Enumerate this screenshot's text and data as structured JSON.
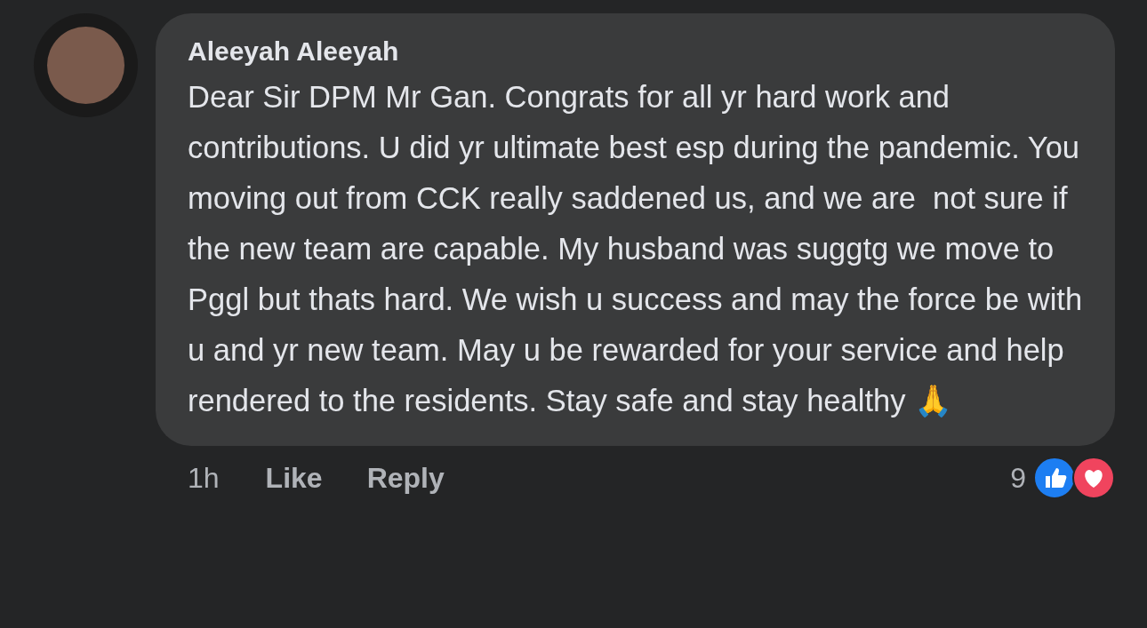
{
  "comment": {
    "author": "Aleeyah Aleeyah",
    "text": "Dear Sir DPM Mr Gan. Congrats for all yr hard work and contributions. U did yr ultimate best esp during the pandemic. You moving out from CCK really saddened us, and we are  not sure if the new team are capable. My husband was suggtg we move to Pggl but thats hard. We wish u success and may the force be with u and yr new team. May u be rewarded for your service and help rendered to the residents. Stay safe and stay healthy 🙏",
    "time": "1h",
    "actions": [
      "Like",
      "Reply"
    ],
    "reaction_count": "9",
    "reactions": [
      {
        "kind": "like"
      },
      {
        "kind": "love"
      }
    ]
  }
}
